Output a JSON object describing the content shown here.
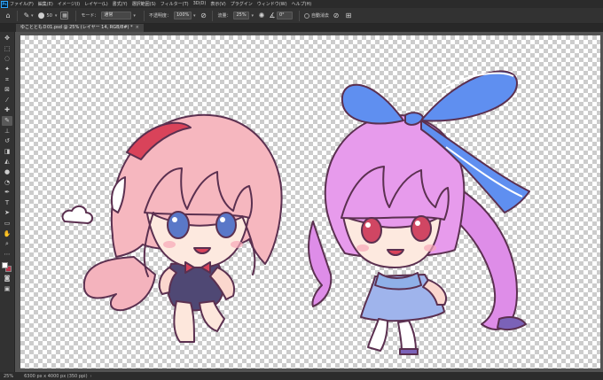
{
  "app": {
    "logo": "Ps"
  },
  "menu": [
    "ファイル(F)",
    "編集(E)",
    "イメージ(I)",
    "レイヤー(L)",
    "書式(Y)",
    "選択範囲(S)",
    "フィルター(T)",
    "3D(D)",
    "表示(V)",
    "プラグイン",
    "ウィンドウ(W)",
    "ヘルプ(H)"
  ],
  "options": {
    "brush_size": "50",
    "mode_label": "モード：",
    "mode_value": "通常",
    "opacity_label": "不透明度：",
    "opacity_value": "100%",
    "flow_label": "流量：",
    "flow_value": "25%",
    "angle_value": "0°",
    "auto_erase_label": "自動消去"
  },
  "document": {
    "tab_title": "ゆことともＤ01.psd @ 25% (レイヤー 14, RGB/8#) *",
    "close_glyph": "×"
  },
  "toolbar": {
    "tools": [
      {
        "name": "move-tool-icon",
        "glyph": "✥"
      },
      {
        "name": "marquee-tool-icon",
        "glyph": "⬚"
      },
      {
        "name": "lasso-tool-icon",
        "glyph": "◌"
      },
      {
        "name": "magic-wand-tool-icon",
        "glyph": "✦"
      },
      {
        "name": "crop-tool-icon",
        "glyph": "⌗"
      },
      {
        "name": "frame-tool-icon",
        "glyph": "⊠"
      },
      {
        "name": "eyedropper-tool-icon",
        "glyph": "⁄"
      },
      {
        "name": "healing-brush-tool-icon",
        "glyph": "✚"
      },
      {
        "name": "brush-tool-icon",
        "glyph": "✎"
      },
      {
        "name": "clone-stamp-tool-icon",
        "glyph": "⊥"
      },
      {
        "name": "history-brush-tool-icon",
        "glyph": "↺"
      },
      {
        "name": "eraser-tool-icon",
        "glyph": "◨"
      },
      {
        "name": "paint-bucket-tool-icon",
        "glyph": "◭"
      },
      {
        "name": "blur-tool-icon",
        "glyph": "●"
      },
      {
        "name": "dodge-tool-icon",
        "glyph": "◔"
      },
      {
        "name": "pen-tool-icon",
        "glyph": "✒"
      },
      {
        "name": "type-tool-icon",
        "glyph": "T"
      },
      {
        "name": "path-selection-tool-icon",
        "glyph": "➤"
      },
      {
        "name": "shape-tool-icon",
        "glyph": "▭"
      },
      {
        "name": "hand-tool-icon",
        "glyph": "✋"
      },
      {
        "name": "zoom-tool-icon",
        "glyph": "⌕"
      },
      {
        "name": "more-tools-icon",
        "glyph": "⋯"
      }
    ],
    "active_tool": "brush-tool-icon",
    "foreground_color": "#ffffff",
    "background_color": "#b7364b",
    "quick_mask_glyph": "◙",
    "screen_mode_glyph": "▣"
  },
  "status": {
    "zoom": "25%",
    "doc_info": "6300 px x 4000 px (350 ppi)",
    "more_glyph": "›"
  },
  "colors": {
    "menubar": "#2b2b2b",
    "panel": "#323232",
    "workspace": "#535353",
    "accent": "#31a8ff"
  }
}
